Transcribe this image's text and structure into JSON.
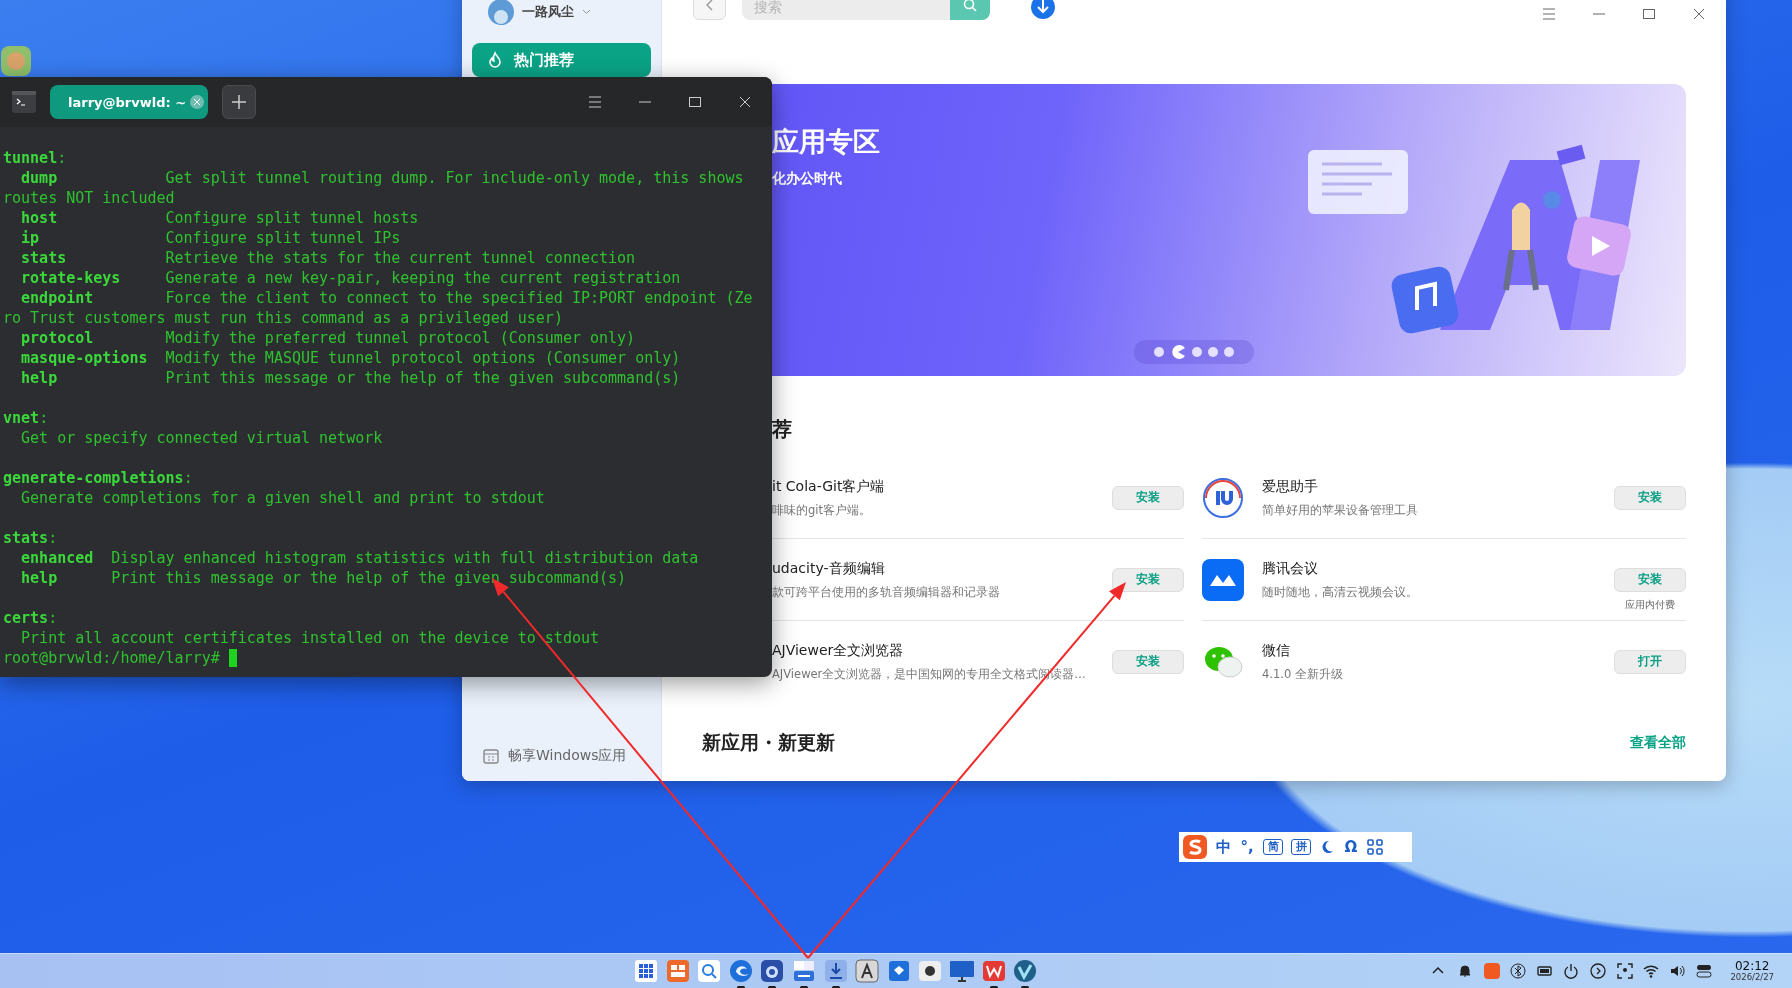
{
  "store_window": {
    "user": {
      "name": "一路风尘"
    },
    "search": {
      "placeholder": "搜索"
    },
    "sidebar": {
      "items": [
        {
          "label": "热门推荐",
          "selected": true
        }
      ],
      "footer": "畅享Windows应用"
    },
    "banner": {
      "title": "应用专区",
      "subtitle": "化办公时代",
      "pager": [
        {
          "selected": false
        },
        {
          "selected": true
        },
        {
          "selected": false
        },
        {
          "selected": false
        },
        {
          "selected": false
        }
      ]
    },
    "recommended": {
      "heading": "荐",
      "apps": [
        {
          "kind": "covered",
          "name": "it Cola-Git客户端",
          "desc": "啡味的git客户端。",
          "action": "安装"
        },
        {
          "kind": "ring",
          "name": "爱思助手",
          "desc": "简单好用的苹果设备管理工具",
          "action": "安装"
        },
        {
          "kind": "covered",
          "name": "udacity-音频编辑",
          "desc": "款可跨平台使用的多轨音频编辑器和记录器",
          "action": "安装"
        },
        {
          "kind": "meeting",
          "name": "腾讯会议",
          "desc": "随时随地，高清云视频会议。",
          "action": "安装",
          "note": "应用内付费"
        },
        {
          "kind": "covered",
          "name": "AJViewer全文浏览器",
          "desc": "AJViewer全文浏览器，是中国知网的专用全文格式阅读器…",
          "action": "安装"
        },
        {
          "kind": "chat",
          "name": "微信",
          "desc": "4.1.0 全新升级",
          "action": "打开"
        }
      ]
    },
    "new_section": {
      "heading": "新应用・新更新",
      "link": "查看全部"
    }
  },
  "terminal": {
    "tab": "larry@brvwld: ~",
    "lines": [
      {
        "kind": "header",
        "text": "**tunnel**:"
      },
      {
        "kind": "entry",
        "name": "dump",
        "desc": "Get split tunnel routing dump. For include-only mode, this shows"
      },
      {
        "kind": "wrap",
        "text": "routes NOT included"
      },
      {
        "kind": "entry",
        "name": "host",
        "desc": "Configure split tunnel hosts"
      },
      {
        "kind": "entry",
        "name": "ip",
        "desc": "Configure split tunnel IPs"
      },
      {
        "kind": "entry",
        "name": "stats",
        "desc": "Retrieve the stats for the current tunnel connection"
      },
      {
        "kind": "entry",
        "name": "rotate-keys",
        "desc": "Generate a new key-pair, keeping the current registration"
      },
      {
        "kind": "entry",
        "name": "endpoint",
        "desc": "Force the client to connect to the specified IP:PORT endpoint (Ze"
      },
      {
        "kind": "wrap",
        "text": "ro Trust customers must run this command as a privileged user)"
      },
      {
        "kind": "entry",
        "name": "protocol",
        "desc": "Modify the preferred tunnel protocol (Consumer only)"
      },
      {
        "kind": "entry",
        "name": "masque-options",
        "desc": "Modify the MASQUE tunnel protocol options (Consumer only)"
      },
      {
        "kind": "entry",
        "name": "help",
        "desc": "Print this message or the help of the given subcommand(s)"
      },
      {
        "kind": "blank"
      },
      {
        "kind": "header",
        "text": "**vnet**:"
      },
      {
        "kind": "plain",
        "text": "Get or specify connected virtual network"
      },
      {
        "kind": "blank"
      },
      {
        "kind": "header",
        "text": "**generate-completions**:"
      },
      {
        "kind": "plain",
        "text": "Generate completions for a given shell and print to stdout"
      },
      {
        "kind": "blank"
      },
      {
        "kind": "header",
        "text": "**stats**:"
      },
      {
        "kind": "entry",
        "name": "enhanced",
        "desc": "Display enhanced histogram statistics with full distribution data"
      },
      {
        "kind": "entry",
        "name": "help",
        "desc": "Print this message or the help of the given subcommand(s)"
      },
      {
        "kind": "blank"
      },
      {
        "kind": "header",
        "text": "**certs**:"
      },
      {
        "kind": "plain",
        "text": "Print all account certificates installed on the device to stdout"
      },
      {
        "kind": "prompt",
        "text": "root@brvwld:/home/larry#"
      }
    ]
  },
  "ime_bar": {
    "items": [
      {
        "kind": "logo"
      },
      {
        "kind": "text",
        "text": "中"
      },
      {
        "kind": "text",
        "text": "°,"
      },
      {
        "kind": "boxed",
        "text": "简"
      },
      {
        "kind": "boxed",
        "text": "拼"
      },
      {
        "kind": "moon"
      },
      {
        "kind": "text",
        "text": "Ω"
      },
      {
        "kind": "grid"
      }
    ]
  },
  "taskbar": {
    "apps": [
      {
        "kind": "launcher",
        "running": false
      },
      {
        "kind": "multitask",
        "running": false
      },
      {
        "kind": "search",
        "running": false
      },
      {
        "kind": "browser",
        "running": true
      },
      {
        "kind": "camera",
        "running": true
      },
      {
        "kind": "calculator",
        "running": true
      },
      {
        "kind": "store",
        "running": true
      },
      {
        "kind": "editor",
        "running": false
      },
      {
        "kind": "package",
        "running": false
      },
      {
        "kind": "recorder",
        "running": false
      },
      {
        "kind": "monitor",
        "running": false
      },
      {
        "kind": "office",
        "running": true
      },
      {
        "kind": "vpn",
        "running": true
      }
    ],
    "clock": {
      "time": "02:12",
      "date": "2026/2/27"
    }
  }
}
